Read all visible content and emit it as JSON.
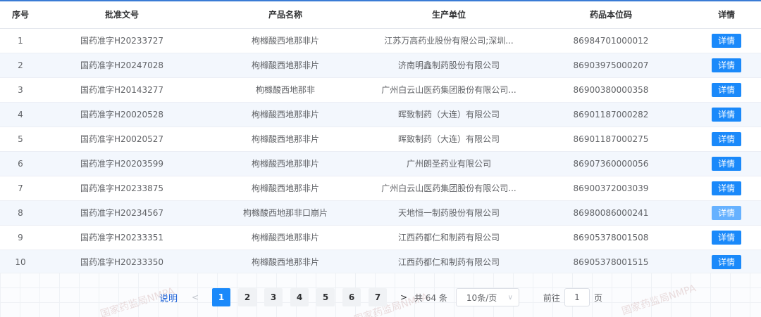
{
  "table": {
    "headers": [
      "序号",
      "批准文号",
      "产品名称",
      "生产单位",
      "药品本位码",
      "详情"
    ],
    "detail_label": "详情",
    "rows": [
      {
        "no": "1",
        "approval": "国药准字H20233727",
        "product": "枸橼酸西地那非片",
        "maker": "江苏万高药业股份有限公司;深圳...",
        "code": "86984701000012"
      },
      {
        "no": "2",
        "approval": "国药准字H20247028",
        "product": "枸橼酸西地那非片",
        "maker": "济南明鑫制药股份有限公司",
        "code": "86903975000207"
      },
      {
        "no": "3",
        "approval": "国药准字H20143277",
        "product": "枸橼酸西地那非",
        "maker": "广州白云山医药集团股份有限公司...",
        "code": "86900380000358"
      },
      {
        "no": "4",
        "approval": "国药准字H20020528",
        "product": "枸橼酸西地那非片",
        "maker": "晖致制药（大连）有限公司",
        "code": "86901187000282"
      },
      {
        "no": "5",
        "approval": "国药准字H20020527",
        "product": "枸橼酸西地那非片",
        "maker": "晖致制药（大连）有限公司",
        "code": "86901187000275"
      },
      {
        "no": "6",
        "approval": "国药准字H20203599",
        "product": "枸橼酸西地那非片",
        "maker": "广州朗圣药业有限公司",
        "code": "86907360000056"
      },
      {
        "no": "7",
        "approval": "国药准字H20233875",
        "product": "枸橼酸西地那非片",
        "maker": "广州白云山医药集团股份有限公司...",
        "code": "86900372003039"
      },
      {
        "no": "8",
        "approval": "国药准字H20234567",
        "product": "枸橼酸西地那非口崩片",
        "maker": "天地恒一制药股份有限公司",
        "code": "86980086000241"
      },
      {
        "no": "9",
        "approval": "国药准字H20233351",
        "product": "枸橼酸西地那非片",
        "maker": "江西药都仁和制药有限公司",
        "code": "86905378001508"
      },
      {
        "no": "10",
        "approval": "国药准字H20233350",
        "product": "枸橼酸西地那非片",
        "maker": "江西药都仁和制药有限公司",
        "code": "86905378001515"
      }
    ]
  },
  "pagination": {
    "note": "说明",
    "prev": "<",
    "next": ">",
    "pages": [
      "1",
      "2",
      "3",
      "4",
      "5",
      "6",
      "7"
    ],
    "active_page": "1",
    "total": "共 64 条",
    "page_size": "10条/页",
    "goto_label": "前往",
    "goto_value": "1",
    "goto_suffix": "页"
  },
  "watermark": "国家药监局NMPA",
  "colors": {
    "accent": "#1a89fa",
    "top_border": "#3a7bd5",
    "stripe": "#f3f7fd"
  }
}
